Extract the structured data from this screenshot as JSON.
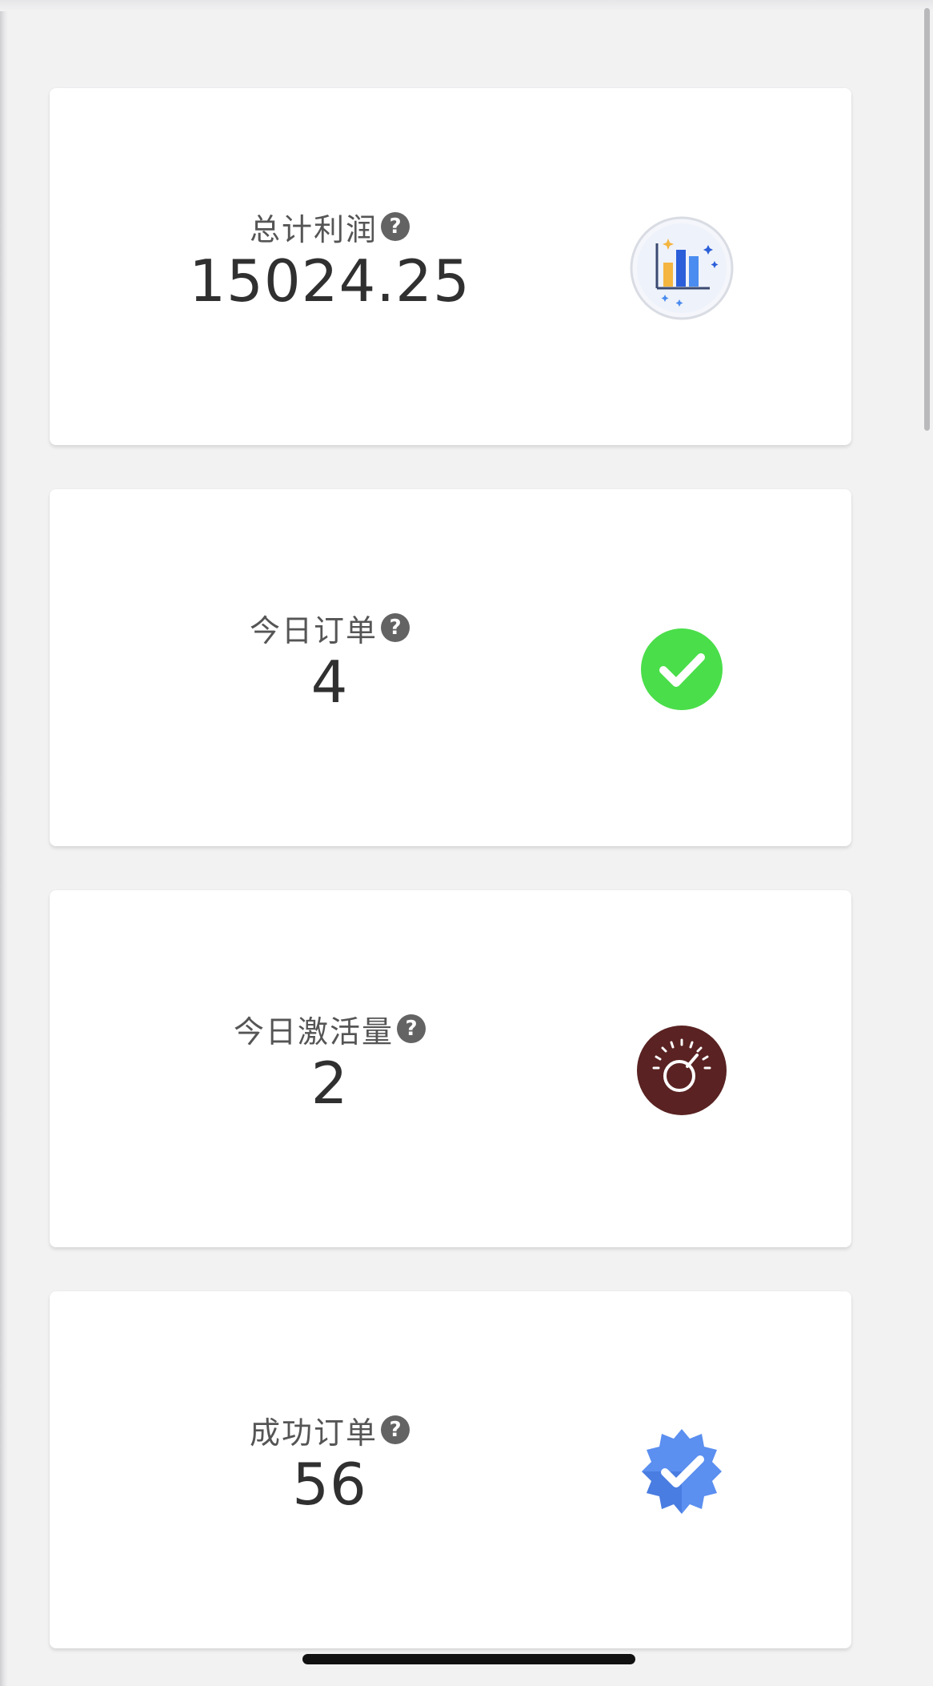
{
  "stats": [
    {
      "label": "总计利润",
      "value": "15024.25",
      "icon": "bar-chart-icon"
    },
    {
      "label": "今日订单",
      "value": "4",
      "icon": "check-circle-icon"
    },
    {
      "label": "今日激活量",
      "value": "2",
      "icon": "gauge-icon"
    },
    {
      "label": "成功订单",
      "value": "56",
      "icon": "verified-badge-icon"
    }
  ],
  "help_glyph": "?",
  "colors": {
    "background": "#f2f2f3",
    "card": "#ffffff",
    "check_green": "#4ade4a",
    "gauge_brown": "#5a2222",
    "badge_blue": "#5b8ff0"
  }
}
